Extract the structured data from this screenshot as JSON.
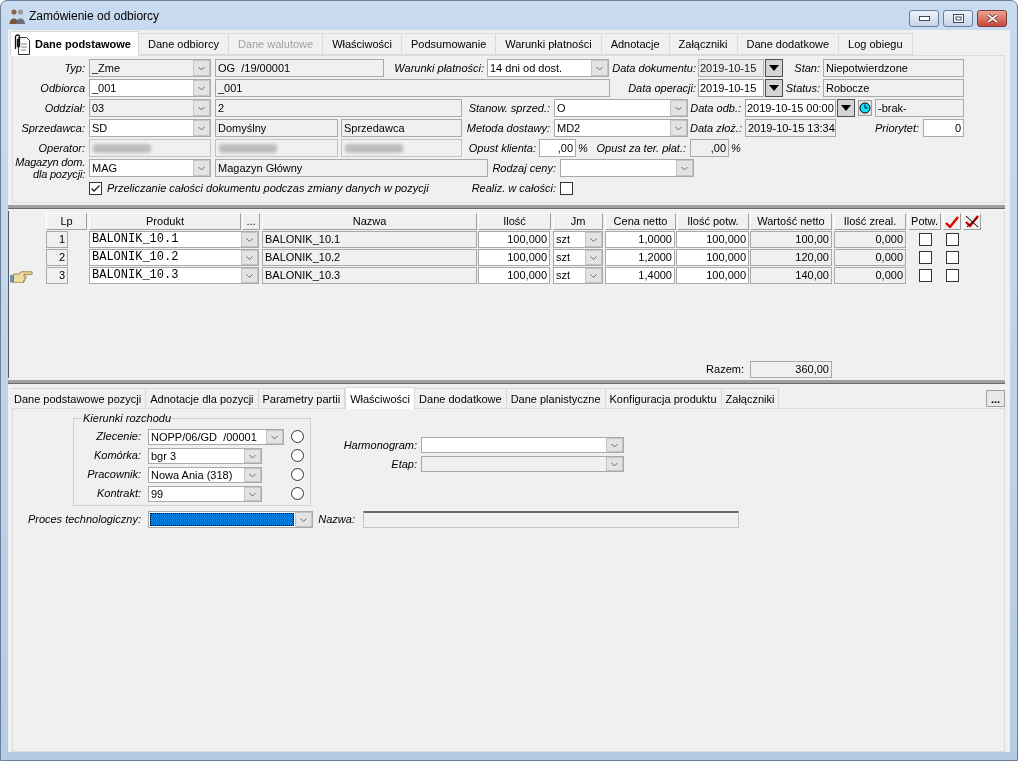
{
  "window": {
    "title": "Zamówienie od odbiorcy"
  },
  "tabs": [
    {
      "label": "Dane podstawowe",
      "selected": true,
      "disabled": false
    },
    {
      "label": "Dane odbiorcy",
      "selected": false,
      "disabled": false
    },
    {
      "label": "Dane walutowe",
      "selected": false,
      "disabled": true
    },
    {
      "label": "Właściwości",
      "selected": false,
      "disabled": false
    },
    {
      "label": "Podsumowanie",
      "selected": false,
      "disabled": false
    },
    {
      "label": "Warunki płatności",
      "selected": false,
      "disabled": false
    },
    {
      "label": "Adnotacje",
      "selected": false,
      "disabled": false
    },
    {
      "label": "Załączniki",
      "selected": false,
      "disabled": false
    },
    {
      "label": "Dane dodatkowe",
      "selected": false,
      "disabled": false
    },
    {
      "label": "Log obiegu",
      "selected": false,
      "disabled": false
    }
  ],
  "header_form": {
    "fields": [
      {
        "label": "Typ:",
        "kind": "combo",
        "value": "_Zme",
        "readonly": true
      },
      {
        "kind": "field",
        "value": "OG  /19/00001"
      },
      {
        "label": "Warunki płatności:",
        "kind": "combo",
        "value": "14 dni od dost.",
        "readonly": false
      },
      {
        "label": "Data dokumentu:",
        "kind": "date",
        "value": "2019-10-15",
        "readonly": true
      },
      {
        "label": "Stan:",
        "kind": "field",
        "value": "Niepotwierdzone"
      },
      {
        "label": "Odbiorca",
        "kind": "combo",
        "value": "_001",
        "readonly": false
      },
      {
        "kind": "field",
        "value": "_001"
      },
      {
        "label": "Data operacji:",
        "kind": "date",
        "value": "2019-10-15",
        "readonly": false
      },
      {
        "label": "Status:",
        "kind": "field",
        "value": "Robocze"
      },
      {
        "label": "Oddział:",
        "kind": "combo",
        "value": "03",
        "readonly": true
      },
      {
        "kind": "field",
        "value": "2"
      },
      {
        "label": "Stanow. sprzed.:",
        "kind": "combo",
        "value": "O",
        "readonly": false
      },
      {
        "label": "Data odb.:",
        "kind": "datetime",
        "value": "2019-10-15 00:00",
        "readonly": false
      },
      {
        "kind": "field",
        "value": "-brak-"
      },
      {
        "label": "Sprzedawca:",
        "kind": "combo",
        "value": "SD",
        "readonly": false
      },
      {
        "kind": "field",
        "value": "Domyślny"
      },
      {
        "kind": "field",
        "value": "Sprzedawca"
      },
      {
        "label": "Metoda dostawy:",
        "kind": "combo",
        "value": "MD2",
        "readonly": false
      },
      {
        "label": "Data złoż.:",
        "kind": "field",
        "value": "2019-10-15 13:34"
      },
      {
        "label": "Priorytet:",
        "kind": "number_input",
        "value": "0"
      },
      {
        "label": "Operator:",
        "kind": "redacted"
      },
      {
        "kind": "redacted"
      },
      {
        "kind": "redacted"
      },
      {
        "label": "Opust klienta:",
        "kind": "number_input",
        "value": ",00",
        "unit": "%"
      },
      {
        "label": "Opust za ter. płat.:",
        "kind": "number_field",
        "value": ",00",
        "unit": "%"
      },
      {
        "label": "Magazyn dom. dla pozycji:",
        "kind": "combo",
        "value": "MAG",
        "readonly": false
      },
      {
        "kind": "field",
        "value": "Magazyn Główny"
      },
      {
        "label": "Rodzaj ceny:",
        "kind": "combo",
        "readonly": false
      },
      {
        "kind": "checkbox",
        "text": "Przeliczanie całości dokumentu podczas zmiany danych w pozycji",
        "checked": true
      },
      {
        "label": "Realiz. w całości:",
        "kind": "checkbox",
        "checked": false
      }
    ]
  },
  "items_table": {
    "columns": [
      "Lp",
      "Produkt",
      "...",
      "Nazwa",
      "Ilość",
      "Jm",
      "Cena netto",
      "Ilość potw.",
      "Wartość netto",
      "Ilość zreal.",
      "Potw."
    ],
    "rows": [
      {
        "lp": "1",
        "product": "BALONIK_10.1",
        "name": "BALONIK_10.1",
        "quantity": "100,000",
        "unit": "szt",
        "net_price": "1,0000",
        "confirmed_quantity": "100,000",
        "net_value": "100,00",
        "realized_quantity": "0,000",
        "confirmed": false,
        "column_13": false,
        "selected": false
      },
      {
        "lp": "2",
        "product": "BALONIK_10.2",
        "name": "BALONIK_10.2",
        "quantity": "100,000",
        "unit": "szt",
        "net_price": "1,2000",
        "confirmed_quantity": "100,000",
        "net_value": "120,00",
        "realized_quantity": "0,000",
        "confirmed": false,
        "column_13": false,
        "selected": false
      },
      {
        "lp": "3",
        "product": "BALONIK_10.3",
        "name": "BALONIK_10.3",
        "quantity": "100,000",
        "unit": "szt",
        "net_price": "1,4000",
        "confirmed_quantity": "100,000",
        "net_value": "140,00",
        "realized_quantity": "0,000",
        "confirmed": false,
        "column_13": false,
        "selected": true
      }
    ],
    "total": {
      "label": "Razem:",
      "value": "360,00"
    }
  },
  "position_tabs": [
    {
      "label": "Dane podstawowe pozycji",
      "selected": false
    },
    {
      "label": "Adnotacje dla pozycji",
      "selected": false
    },
    {
      "label": "Parametry partii",
      "selected": false
    },
    {
      "label": "Właściwości",
      "selected": true
    },
    {
      "label": "Dane dodatkowe",
      "selected": false
    },
    {
      "label": "Dane planistyczne",
      "selected": false
    },
    {
      "label": "Konfiguracja produktu",
      "selected": false
    },
    {
      "label": "Załączniki",
      "selected": false
    }
  ],
  "more_button": {
    "label": "..."
  },
  "position_panel": {
    "group": {
      "title": "Kierunki rozchodu",
      "rows": [
        {
          "label": "Zlecenie:",
          "value": "NOPP/06/GD  /00001",
          "selected": false
        },
        {
          "label": "Komórka:",
          "value": "bgr 3",
          "selected": false
        },
        {
          "label": "Pracownik:",
          "value": "Nowa Ania (318)",
          "selected": false
        },
        {
          "label": "Kontrakt:",
          "value": "99",
          "selected": false
        }
      ]
    },
    "schedule": {
      "label": "Harmonogram:",
      "readonly": false
    },
    "stage": {
      "label": "Etap:",
      "readonly": true
    },
    "process": {
      "label": "Proces technologiczny:",
      "focused": true
    },
    "name": {
      "label": "Nazwa:"
    }
  }
}
